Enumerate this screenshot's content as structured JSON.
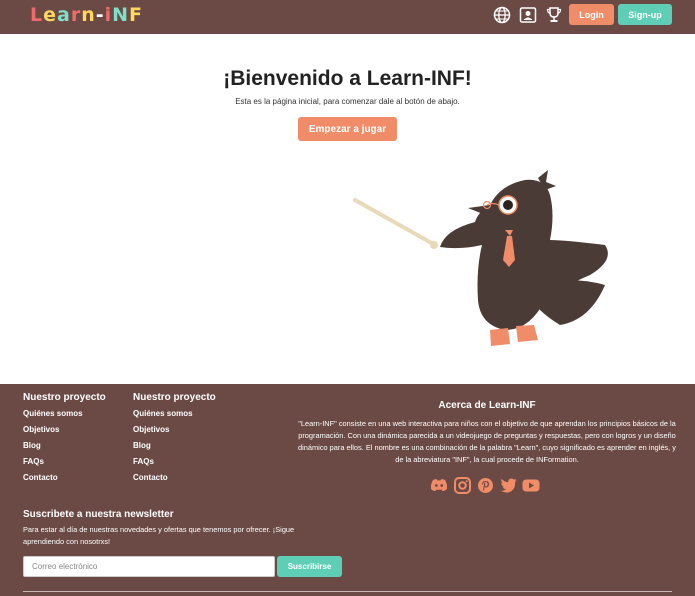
{
  "header": {
    "logo_letters": [
      {
        "char": "L",
        "color": "#f26b6b"
      },
      {
        "char": "e",
        "color": "#ffd85c"
      },
      {
        "char": "a",
        "color": "#7ee0c8"
      },
      {
        "char": "r",
        "color": "#f26b6b"
      },
      {
        "char": "n",
        "color": "#ffd85c"
      },
      {
        "char": "-",
        "color": "#ffffff"
      },
      {
        "char": "i",
        "color": "#f26b6b"
      },
      {
        "char": "N",
        "color": "#7ee0c8"
      },
      {
        "char": "F",
        "color": "#ffd85c"
      }
    ],
    "icons": [
      "globe-icon",
      "profile-card-icon",
      "trophy-icon"
    ],
    "login_label": "Login",
    "signup_label": "Sign-up"
  },
  "hero": {
    "title": "¡Bienvenido a Learn-INF!",
    "subtitle": "Esta es la página inicial, para comenzar dale al botón de abajo.",
    "start_label": "Empezar a jugar"
  },
  "footer": {
    "col1": {
      "title": "Nuestro proyecto",
      "links": [
        "Quiénes somos",
        "Objetivos",
        "Blog",
        "FAQs",
        "Contacto"
      ]
    },
    "col2": {
      "title": "Nuestro proyecto",
      "links": [
        "Quiénes somos",
        "Objetivos",
        "Blog",
        "FAQs",
        "Contacto"
      ]
    },
    "about": {
      "title": "Acerca de Learn-INF",
      "text": "\"Learn-INF\" consiste en una web interactiva para niños con el objetivo de que aprendan los principios básicos de la programación. Con una dinámica parecida a un videojuego de preguntas y respuestas, pero con logros y un diseño dinámico para ellos. El nombre es una combinación de la palabra \"Learn\", cuyo significado es aprender en inglés, y de la abreviatura \"INF\", la cual procede de INFormation."
    },
    "socials": [
      "discord-icon",
      "instagram-icon",
      "pinterest-icon",
      "twitter-icon",
      "youtube-icon"
    ],
    "newsletter": {
      "title": "Suscribete a nuestra newsletter",
      "text": "Para estar al día de nuestras novedades y ofertas que tenemos por ofrecer. ¡Sigue aprendiendo con nosotrxs!",
      "placeholder": "Correo electrónico",
      "button_label": "Suscribirse"
    }
  },
  "colors": {
    "brand_brown": "#6b4a45",
    "accent_orange": "#f08c68",
    "accent_teal": "#5ecfb6"
  }
}
